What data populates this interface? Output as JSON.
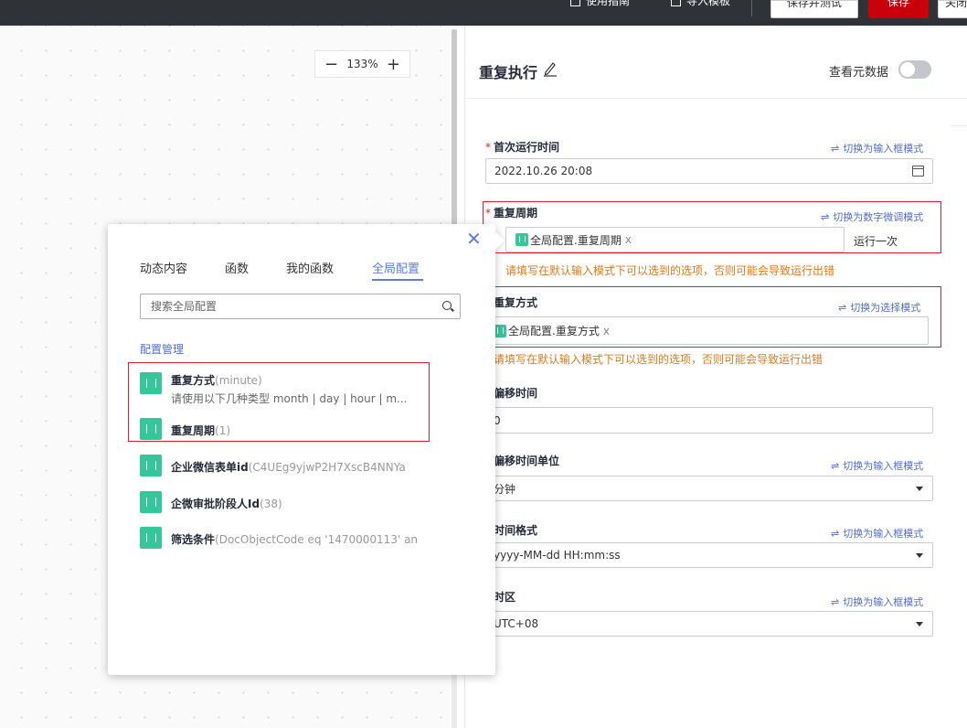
{
  "topbar": {
    "guide": "使用指南",
    "import_template": "导入模板",
    "save_and_test": "保存并测试",
    "save": "保存",
    "close": "关闭"
  },
  "canvas": {
    "zoom_out": "−",
    "zoom_level": "133%",
    "zoom_in": "+"
  },
  "panel": {
    "title": "重复执行",
    "view_metadata": "查看元数据",
    "fields": {
      "first_run": {
        "label": "首次运行时间",
        "switch": "切换为输入框模式",
        "value": "2022.10.26 20:08"
      },
      "period": {
        "label": "重复周期",
        "switch": "切换为数字微调模式",
        "chip": "全局配置.重复周期",
        "chip_x": "x",
        "run_once": "运行一次",
        "warning": "请填写在默认输入模式下可以选到的选项，否则可能会导致运行出错"
      },
      "mode": {
        "label": "重复方式",
        "switch": "切换为选择模式",
        "chip": "全局配置.重复方式",
        "chip_x": "x",
        "warning": "请填写在默认输入模式下可以选到的选项，否则可能会导致运行出错"
      },
      "offset": {
        "label": "偏移时间",
        "value": "0"
      },
      "offset_unit": {
        "label": "偏移时间单位",
        "switch": "切换为输入框模式",
        "value": "分钟"
      },
      "time_format": {
        "label": "时间格式",
        "switch": "切换为输入框模式",
        "value": "yyyy-MM-dd HH:mm:ss"
      },
      "timezone": {
        "label": "时区",
        "switch": "切换为输入框模式",
        "value": "UTC+08"
      }
    }
  },
  "popover": {
    "tabs": [
      "动态内容",
      "函数",
      "我的函数",
      "全局配置"
    ],
    "active_tab": "全局配置",
    "search_placeholder": "搜索全局配置",
    "config_manage": "配置管理",
    "close_icon": "✕",
    "items": [
      {
        "name": "重复方式",
        "value": "(minute)",
        "desc": "请使用以下几种类型 month | day | hour | m..."
      },
      {
        "name": "重复周期",
        "value": "(1)"
      },
      {
        "name": "企业微信表单id",
        "value": "(C4UEg9yjwP2H7XscB4NNYa"
      },
      {
        "name": "企微审批阶段人Id",
        "value": "(38)"
      },
      {
        "name": "筛选条件",
        "value": "(DocObjectCode eq '1470000113' an"
      }
    ]
  },
  "colors": {
    "accent": "#5e7ce0",
    "link": "#526ecc",
    "danger": "#e02020",
    "warning": "#e07a1a",
    "tag_green": "#33c79a",
    "save_red": "#c7000b"
  }
}
